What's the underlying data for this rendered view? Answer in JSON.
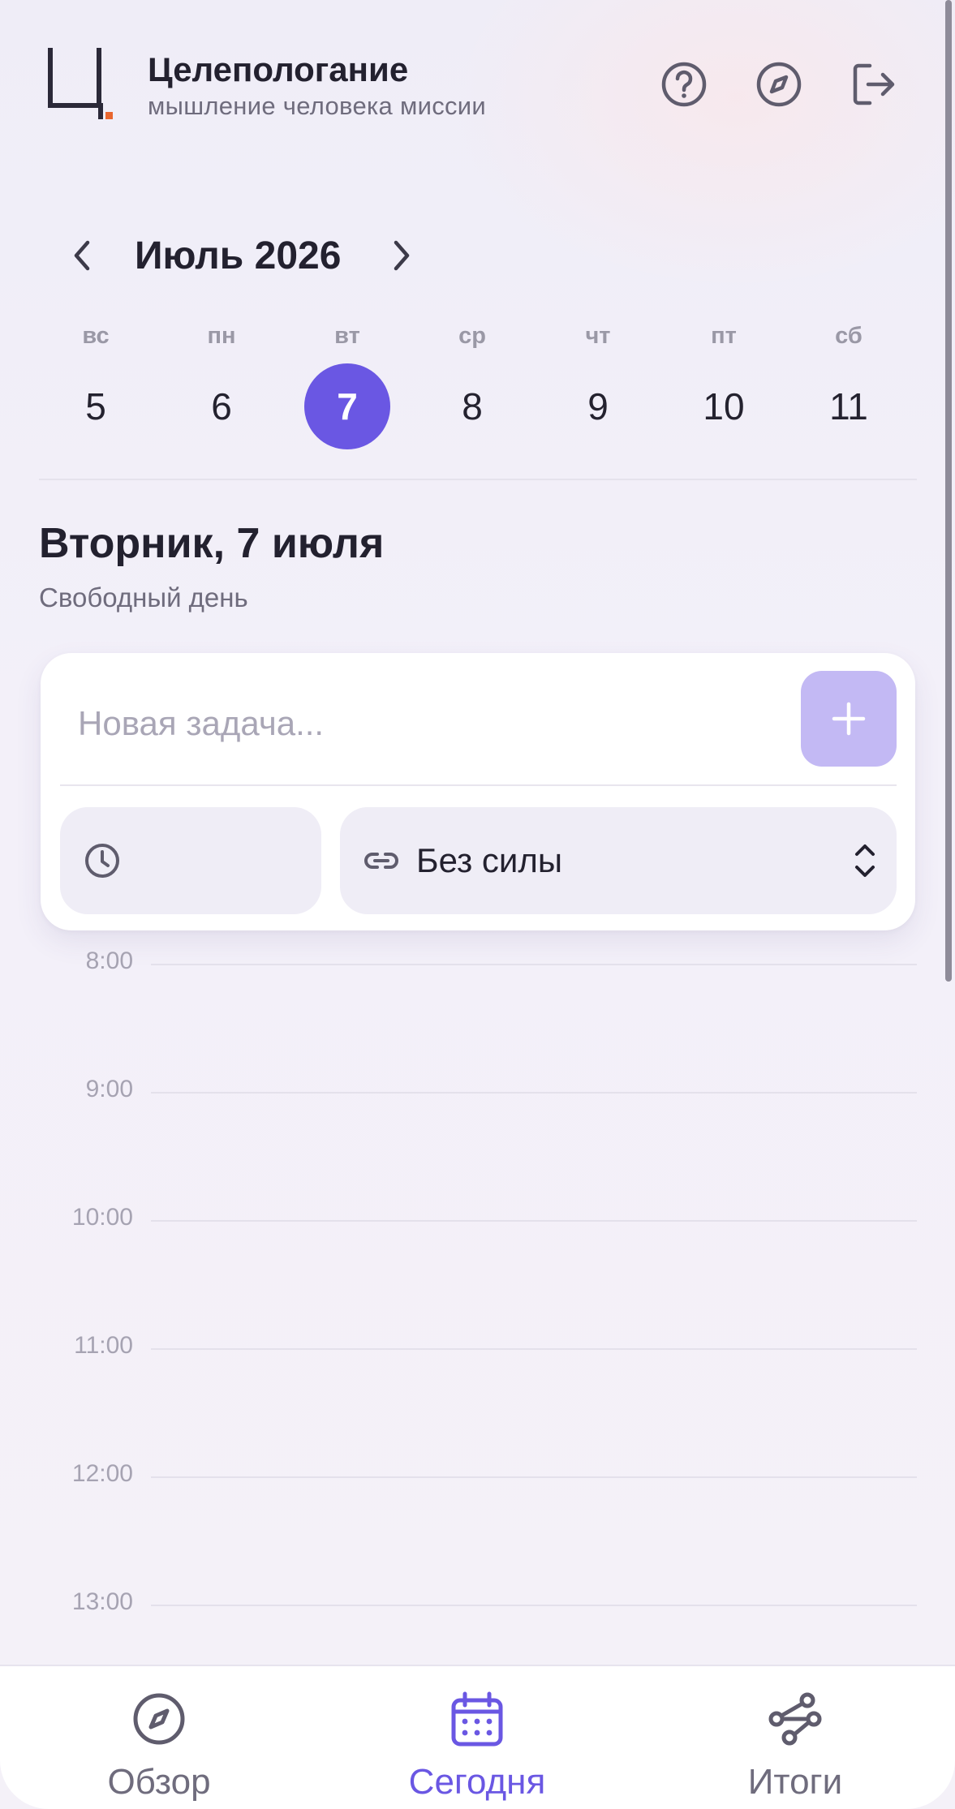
{
  "header": {
    "logo_icon": "app-logo-icon",
    "title": "Целепологание",
    "subtitle": "мышление человека миссии",
    "actions": [
      {
        "icon": "help-icon"
      },
      {
        "icon": "compass-icon"
      },
      {
        "icon": "logout-icon"
      }
    ]
  },
  "calendar": {
    "month_label": "Июль 2026",
    "days": [
      {
        "name": "вс",
        "num": "5"
      },
      {
        "name": "пн",
        "num": "6"
      },
      {
        "name": "вт",
        "num": "7",
        "selected": true
      },
      {
        "name": "ср",
        "num": "8"
      },
      {
        "name": "чт",
        "num": "9"
      },
      {
        "name": "пт",
        "num": "10"
      },
      {
        "name": "сб",
        "num": "11"
      }
    ]
  },
  "day": {
    "title": "Вторник, 7 июля",
    "subtitle": "Свободный день"
  },
  "task_form": {
    "placeholder": "Новая задача...",
    "value": "",
    "power_select": "Без силы"
  },
  "timeline": {
    "hours": [
      "8:00",
      "9:00",
      "10:00",
      "11:00",
      "12:00",
      "13:00"
    ]
  },
  "nav": {
    "items": [
      {
        "label": "Обзор",
        "icon": "compass-icon"
      },
      {
        "label": "Сегодня",
        "icon": "calendar-icon",
        "active": true
      },
      {
        "label": "Итоги",
        "icon": "route-icon"
      }
    ]
  },
  "colors": {
    "accent": "#6a57e3",
    "accent_light": "#c3b9f4",
    "text_primary": "#23212f",
    "text_secondary": "#6f6c7d",
    "logo_dot": "#e8662e"
  }
}
